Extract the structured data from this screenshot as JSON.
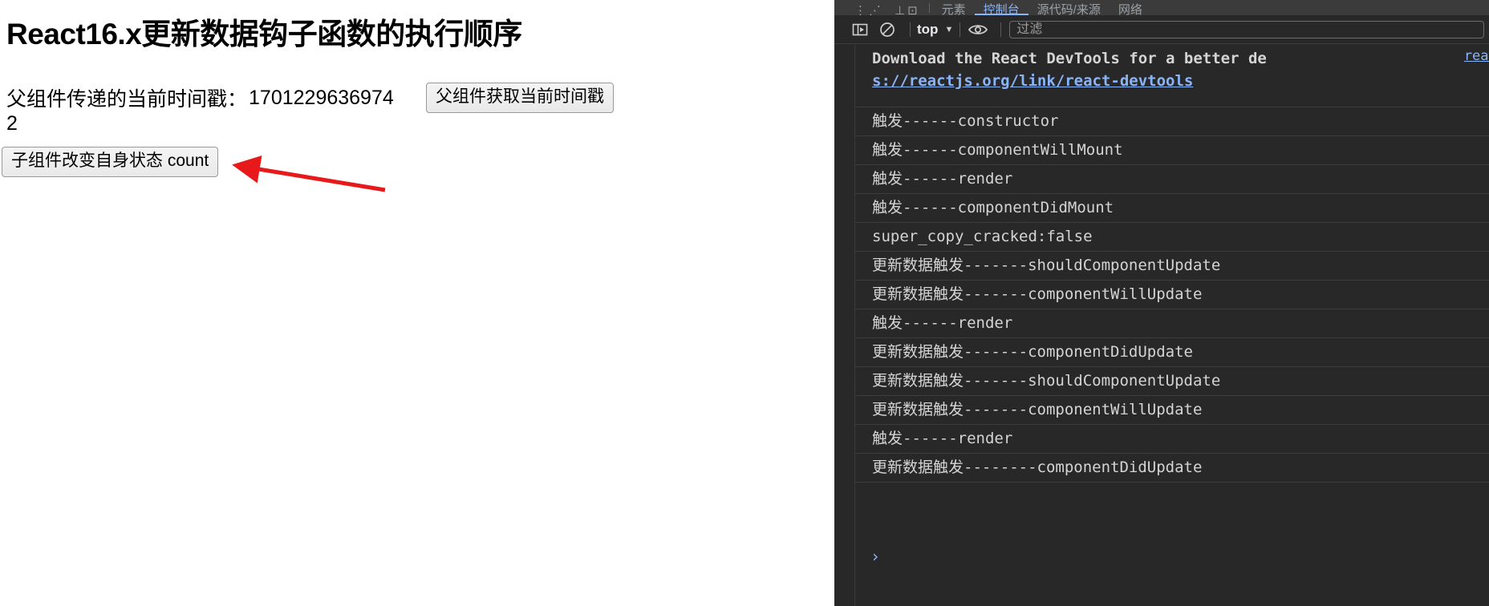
{
  "page": {
    "title": "React16.x更新数据钩子函数的执行顺序",
    "timestamp_label": "父组件传递的当前时间戳：",
    "timestamp_value": "1701229636974",
    "parent_button_label": "父组件获取当前时间戳",
    "count_value": "2",
    "child_button_label": "子组件改变自身状态 count",
    "annotation_arrow_color": "#e8191b"
  },
  "devtools": {
    "tabs": [
      {
        "label": "⋮⋰",
        "active": false,
        "icon": true
      },
      {
        "label": "⊥⊡",
        "active": false,
        "icon": true
      },
      {
        "label": "元素",
        "active": false,
        "icon": false
      },
      {
        "label": "控制台",
        "active": true,
        "icon": false
      },
      {
        "label": "源代码/来源",
        "active": false,
        "icon": false
      },
      {
        "label": "网络",
        "active": false,
        "icon": false
      }
    ],
    "toolbar": {
      "sidebar_toggle_name": "show-console-sidebar",
      "clear_console_name": "clear-console",
      "context_label": "top",
      "context_caret": "▼",
      "eye_name": "live-expression",
      "filter_placeholder": "过滤"
    },
    "console": {
      "accent_link_color": "#8ab4f8",
      "highlight_color": "#ff0000",
      "prompt_caret": "›",
      "rows": [
        {
          "type": "banner",
          "source": "react",
          "text": "Download the React DevTools for a better de",
          "link": "s://reactjs.org/link/react-devtools"
        },
        {
          "type": "log",
          "text": "触发------constructor"
        },
        {
          "type": "log",
          "text": "触发------componentWillMount"
        },
        {
          "type": "log",
          "text": "触发------render"
        },
        {
          "type": "log",
          "text": "触发------componentDidMount"
        },
        {
          "type": "log",
          "text": "super_copy_cracked:false"
        },
        {
          "type": "log",
          "text": "更新数据触发-------shouldComponentUpdate"
        },
        {
          "type": "log",
          "text": "更新数据触发-------componentWillUpdate"
        },
        {
          "type": "log",
          "text": "触发------render"
        },
        {
          "type": "log",
          "text": "更新数据触发-------componentDidUpdate"
        },
        {
          "type": "log",
          "text": "更新数据触发-------shouldComponentUpdate"
        },
        {
          "type": "log",
          "text": "更新数据触发-------componentWillUpdate"
        },
        {
          "type": "log",
          "text": "触发------render"
        },
        {
          "type": "log",
          "text": "更新数据触发--------componentDidUpdate"
        }
      ]
    }
  }
}
